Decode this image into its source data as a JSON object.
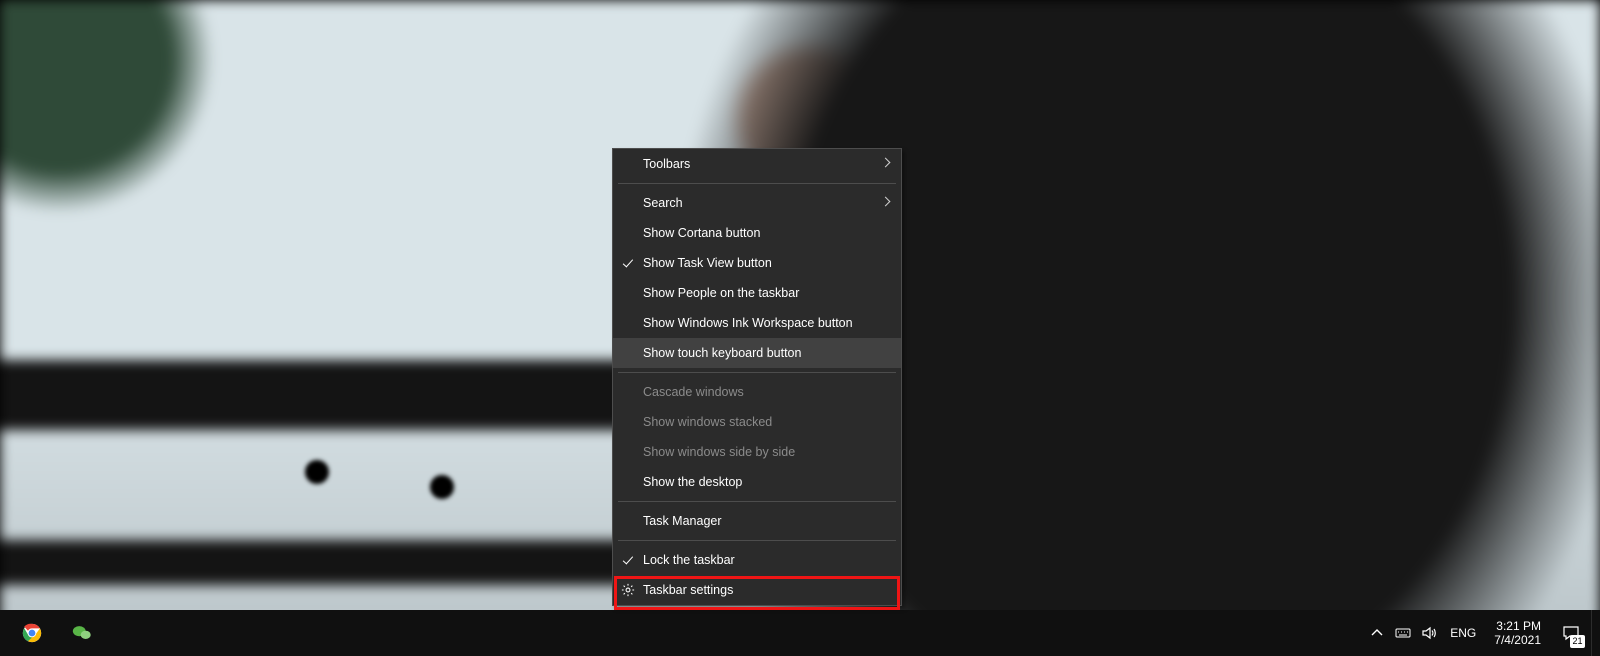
{
  "context_menu": {
    "items": [
      {
        "label": "Toolbars",
        "submenu": true
      },
      {
        "label": "Search",
        "submenu": true
      },
      {
        "label": "Show Cortana button"
      },
      {
        "label": "Show Task View button",
        "checked": true
      },
      {
        "label": "Show People on the taskbar"
      },
      {
        "label": "Show Windows Ink Workspace button"
      },
      {
        "label": "Show touch keyboard button",
        "hovered": true
      },
      {
        "label": "Cascade windows",
        "disabled": true
      },
      {
        "label": "Show windows stacked",
        "disabled": true
      },
      {
        "label": "Show windows side by side",
        "disabled": true
      },
      {
        "label": "Show the desktop"
      },
      {
        "label": "Task Manager"
      },
      {
        "label": "Lock the taskbar",
        "checked": true
      },
      {
        "label": "Taskbar settings",
        "icon": "gear",
        "highlighted": true
      }
    ]
  },
  "taskbar": {
    "pinned": [
      {
        "name": "chrome"
      },
      {
        "name": "wechat"
      }
    ],
    "tray": {
      "overflow_icon": "chevron-up",
      "keyboard_icon": "keyboard",
      "volume_icon": "speaker",
      "language": "ENG"
    },
    "clock": {
      "time": "3:21 PM",
      "date": "7/4/2021"
    },
    "action_center": {
      "badge": "21"
    }
  },
  "annotation": {
    "highlight_color": "#ef1515"
  }
}
